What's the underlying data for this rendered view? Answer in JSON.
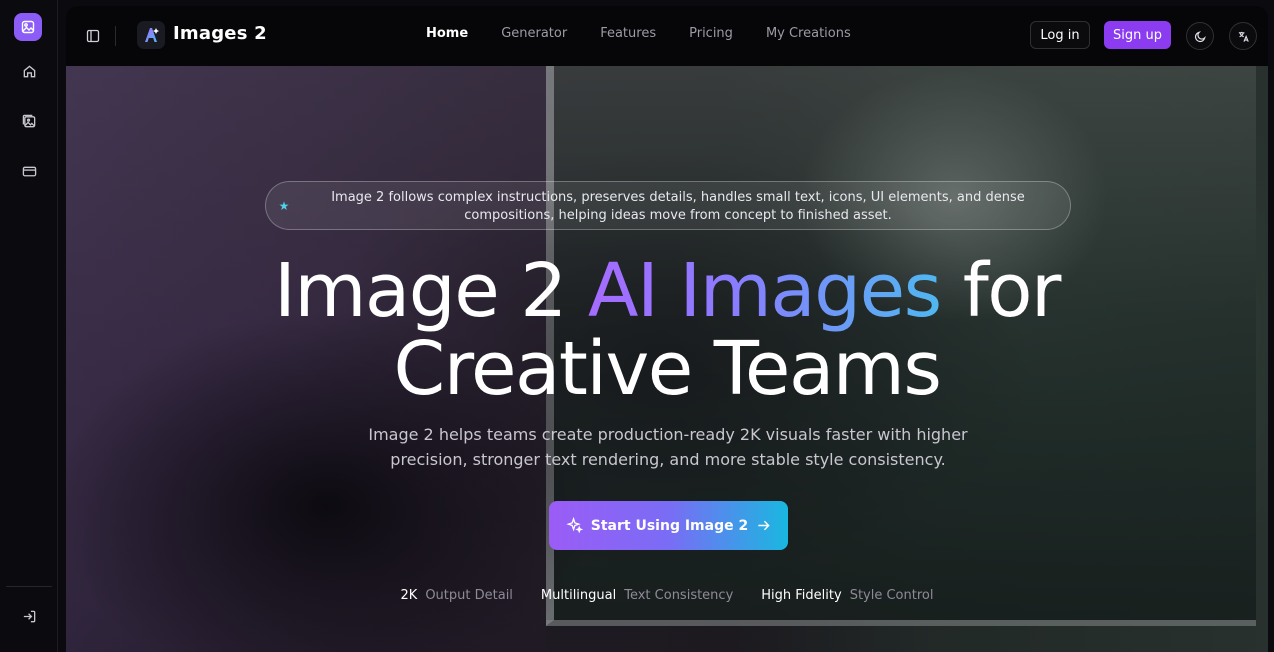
{
  "app": {
    "name": "Images 2"
  },
  "nav": {
    "items": [
      {
        "label": "Home",
        "active": true
      },
      {
        "label": "Generator",
        "active": false
      },
      {
        "label": "Features",
        "active": false
      },
      {
        "label": "Pricing",
        "active": false
      },
      {
        "label": "My Creations",
        "active": false
      }
    ]
  },
  "header": {
    "login_label": "Log in",
    "signup_label": "Sign up"
  },
  "hero": {
    "badge_text": "Image 2 follows complex instructions, preserves details, handles small text, icons, UI elements, and dense compositions, helping ideas move from concept to finished asset.",
    "title_part1": "Image 2 ",
    "title_highlight": "AI Images",
    "title_part2": " for",
    "title_line2": "Creative Teams",
    "subtitle": "Image 2 helps teams create production-ready 2K visuals faster with higher precision, stronger text rendering, and more stable style consistency.",
    "cta_label": "Start Using Image 2"
  },
  "stats": [
    {
      "value": "2K",
      "label": "Output Detail"
    },
    {
      "value": "Multilingual",
      "label": "Text Consistency"
    },
    {
      "value": "High Fidelity",
      "label": "Style Control"
    }
  ],
  "colors": {
    "accent": "#8b3cf0",
    "cta_start": "#9b5cf6",
    "cta_end": "#19b8e0"
  }
}
